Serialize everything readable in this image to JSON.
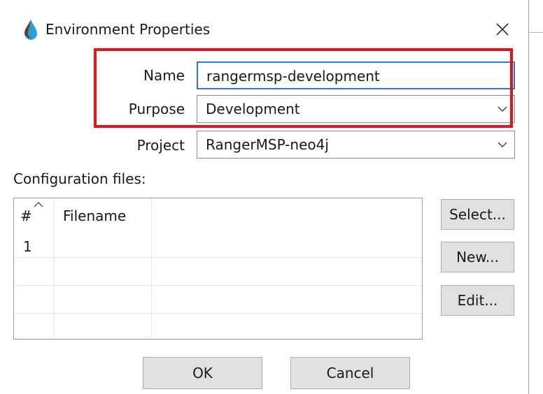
{
  "window": {
    "title": "Environment Properties",
    "close_icon": "close-icon"
  },
  "form": {
    "name_label": "Name",
    "name_value": "rangermsp-development",
    "purpose_label": "Purpose",
    "purpose_value": "Development",
    "project_label": "Project",
    "project_value": "RangerMSP-neo4j"
  },
  "config": {
    "section_label": "Configuration files:",
    "columns": [
      "#",
      "Filename"
    ],
    "rows": [
      {
        "num": "1",
        "filename": ""
      }
    ]
  },
  "buttons": {
    "select": "Select...",
    "new": "New...",
    "edit": "Edit...",
    "ok": "OK",
    "cancel": "Cancel"
  },
  "colors": {
    "highlight": "#e0151b",
    "focus": "#2f73c8",
    "app_icon": "#2a9fd6"
  }
}
